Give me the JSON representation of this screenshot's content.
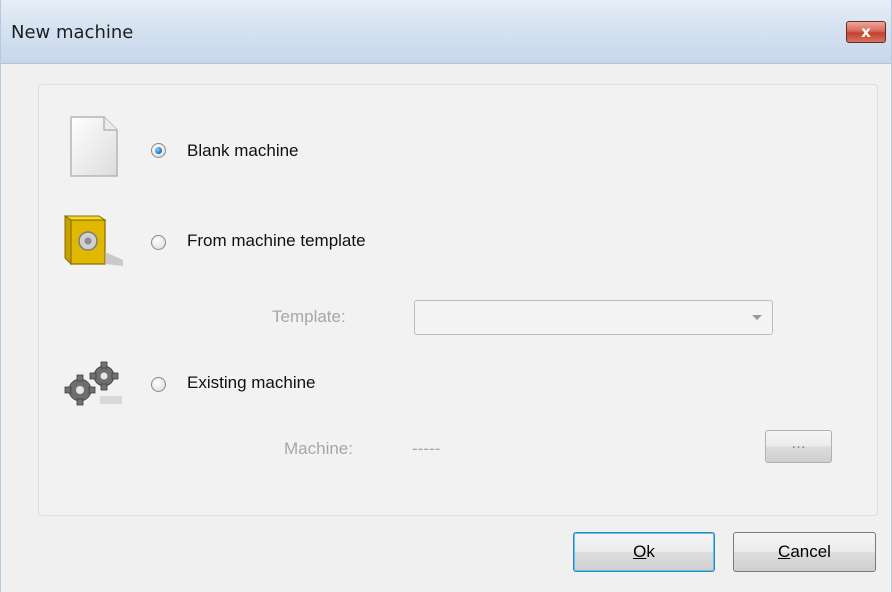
{
  "window": {
    "title": "New machine",
    "close_label": "x"
  },
  "options": {
    "blank": {
      "label": "Blank machine",
      "selected": true,
      "icon": "blank-document-icon"
    },
    "template": {
      "label": "From machine template",
      "selected": false,
      "icon": "template-box-icon"
    },
    "existing": {
      "label": "Existing machine",
      "selected": false,
      "icon": "gears-icon"
    }
  },
  "template_field": {
    "label": "Template:",
    "value": ""
  },
  "machine_field": {
    "label": "Machine:",
    "value": "-----",
    "browse_label": "..."
  },
  "buttons": {
    "ok_accel": "O",
    "ok_rest": "k",
    "cancel_accel": "C",
    "cancel_rest": "ancel"
  }
}
